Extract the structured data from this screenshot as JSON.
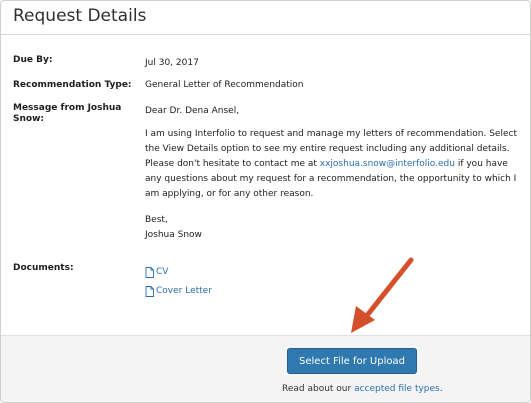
{
  "header": {
    "title": "Request Details"
  },
  "details": {
    "due_by_label": "Due By:",
    "due_by_value": "Jul 30, 2017",
    "type_label": "Recommendation Type:",
    "type_value": "General Letter of Recommendation",
    "message_label": "Message from Joshua Snow:",
    "message": {
      "greeting": "Dear Dr. Dena Ansel,",
      "body_before": "I am using Interfolio to request and manage my letters of recommendation. Select the View Details option to see my entire request including any additional details. Please don't hesitate to contact me at ",
      "email": "xxjoshua.snow@interfolio.edu",
      "body_after": " if you have any questions about my request for a recommendation, the opportunity to which I am applying, or for any other reason.",
      "closing": "Best,",
      "signature": "Joshua Snow"
    },
    "documents_label": "Documents:",
    "documents": [
      {
        "name": "CV",
        "icon": "document-icon"
      },
      {
        "name": "Cover Letter",
        "icon": "document-icon"
      }
    ]
  },
  "footer": {
    "upload_button": "Select File for Upload",
    "read_about_prefix": "Read about our ",
    "accepted_link": "accepted file types",
    "read_about_suffix": "."
  },
  "colors": {
    "accent": "#2f79b0",
    "link": "#2a6fb0",
    "annotation_arrow": "#d4502a"
  }
}
